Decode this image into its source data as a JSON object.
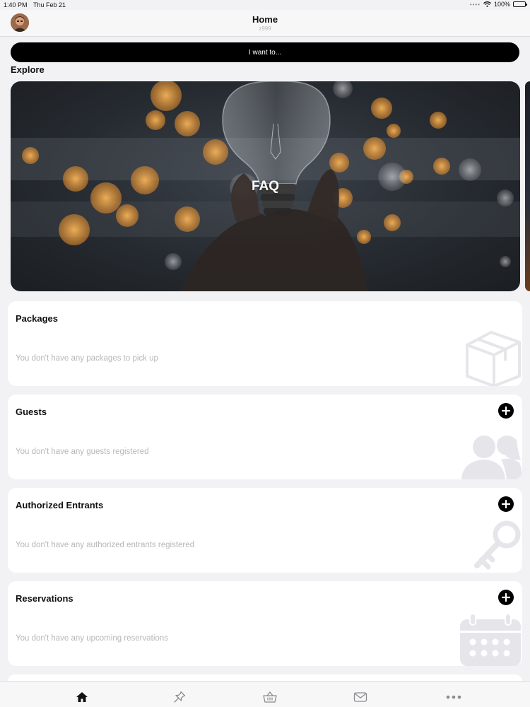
{
  "status_bar": {
    "time": "1:40 PM",
    "date": "Thu Feb 21",
    "battery": "100%",
    "battery_level": 1.0
  },
  "header": {
    "title": "Home",
    "subtitle": "z999"
  },
  "action_button": {
    "label": "I want to..."
  },
  "explore": {
    "heading": "Explore",
    "cards": [
      {
        "label": "FAQ"
      }
    ]
  },
  "sections": {
    "packages": {
      "title": "Packages",
      "empty_message": "You don't have any packages to pick up",
      "icon": "package-box-icon"
    },
    "guests": {
      "title": "Guests",
      "empty_message": "You don't have any guests registered",
      "icon": "people-icon"
    },
    "authorized_entrants": {
      "title": "Authorized Entrants",
      "empty_message": "You don't have any authorized entrants registered",
      "icon": "key-icon"
    },
    "reservations": {
      "title": "Reservations",
      "empty_message": "You don't have any upcoming reservations",
      "icon": "calendar-icon"
    }
  },
  "tab_bar": {
    "items": [
      {
        "icon": "home-icon",
        "active": true
      },
      {
        "icon": "pin-icon",
        "active": false
      },
      {
        "icon": "basket-icon",
        "active": false
      },
      {
        "icon": "mail-icon",
        "active": false
      },
      {
        "icon": "more-icon",
        "active": false
      }
    ]
  },
  "colors": {
    "background": "#f2f2f4",
    "card": "#ffffff",
    "accent": "#000000",
    "muted_text": "#b7b7bb",
    "illustration": "#e6e6ea"
  }
}
